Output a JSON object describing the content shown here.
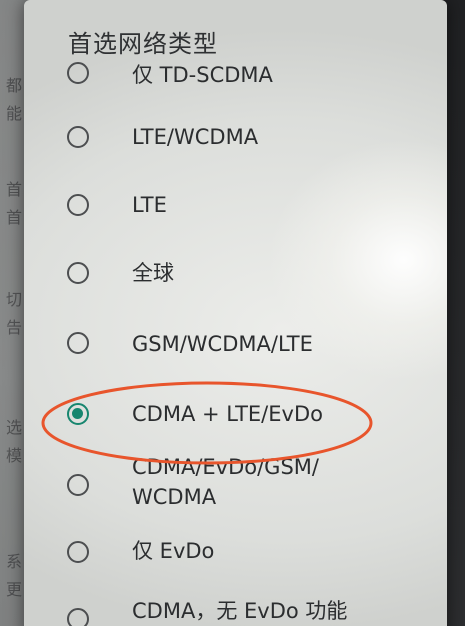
{
  "background_page": {
    "left_glyphs": [
      "都",
      "能",
      "首",
      "首",
      "切",
      "告",
      "选",
      "模",
      "系",
      "更"
    ]
  },
  "dialog": {
    "title": "首选网络类型",
    "options": [
      {
        "label": "仅 TD-SCDMA",
        "selected": false
      },
      {
        "label": "LTE/WCDMA",
        "selected": false
      },
      {
        "label": "LTE",
        "selected": false
      },
      {
        "label": "全球",
        "selected": false
      },
      {
        "label": "GSM/WCDMA/LTE",
        "selected": false
      },
      {
        "label": "CDMA + LTE/EvDo",
        "selected": true
      },
      {
        "label": "CDMA/EvDo/GSM/\nWCDMA",
        "selected": false
      },
      {
        "label": "仅 EvDo",
        "selected": false
      },
      {
        "label": "CDMA，无 EvDo 功能",
        "selected": false
      }
    ]
  },
  "annotation": {
    "color": "#e8552c",
    "target": "CDMA + LTE/EvDo"
  },
  "colors": {
    "radio_selected": "#17866f",
    "radio_unselected": "#4c4e50",
    "text": "#2b2d2f"
  }
}
